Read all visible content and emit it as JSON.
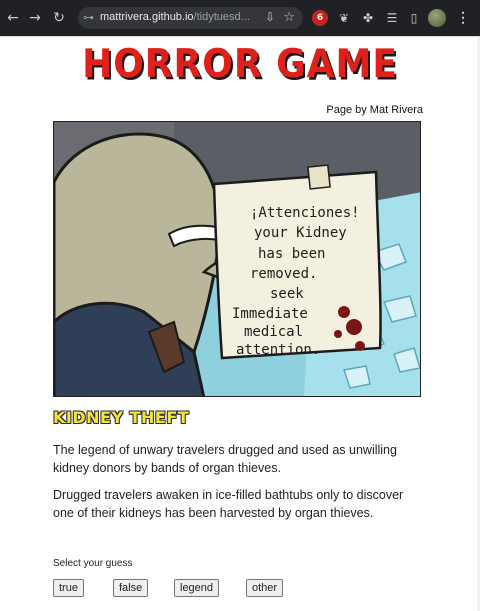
{
  "browser": {
    "url_host": "mattrivera.github.io",
    "url_path": "/tidytuesd...",
    "back_icon": "arrow-left",
    "forward_icon": "arrow-right",
    "reload_icon": "reload",
    "extension_badge": "6"
  },
  "page": {
    "title": "HORROR GAME",
    "byline": "Page by Mat Rivera",
    "hero_note": {
      "lines": [
        "¡Attenciones!",
        "your Kidney",
        "has been",
        "removed.",
        "seek",
        "Immediate",
        "medical",
        "attention."
      ]
    },
    "legend_title": "KIDNEY THEFT",
    "paragraphs": [
      "The legend of unwary travelers drugged and used as unwilling kidney donors by bands of organ thieves.",
      "Drugged travelers awaken in ice-filled bathtubs only to discover one of their kidneys has been harvested by organ thieves."
    ],
    "guess_prompt": "Select your guess",
    "guess_options": [
      "true",
      "false",
      "legend",
      "other"
    ]
  }
}
